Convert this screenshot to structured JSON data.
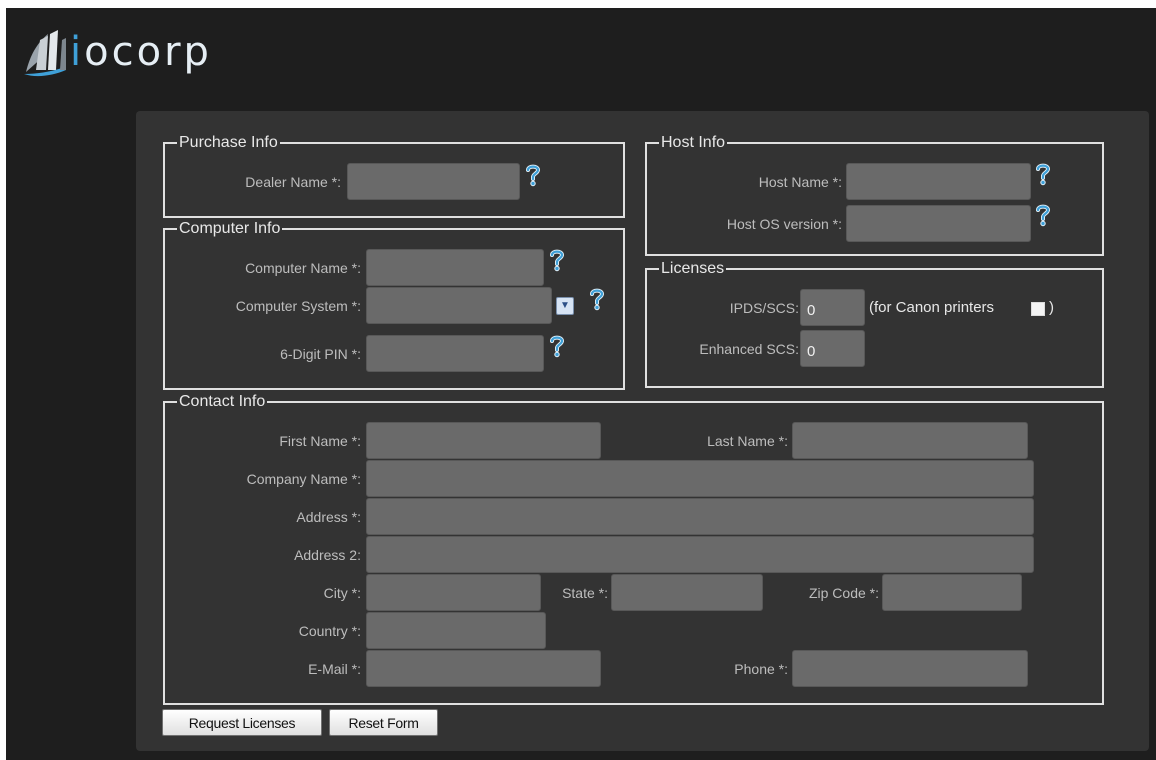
{
  "brand": {
    "logo_text": "iocorp",
    "logo_prefix": "i",
    "logo_rest": "ocorp"
  },
  "sections": {
    "purchase": {
      "legend": "Purchase Info",
      "dealer_label": "Dealer Name *:",
      "dealer_value": ""
    },
    "computer": {
      "legend": "Computer Info",
      "name_label": "Computer Name *:",
      "name_value": "",
      "system_label": "Computer System *:",
      "system_value": "",
      "pin_label": "6-Digit PIN *:",
      "pin_value": ""
    },
    "host": {
      "legend": "Host Info",
      "name_label": "Host Name *:",
      "name_value": "",
      "os_label": "Host OS version *:",
      "os_value": ""
    },
    "licenses": {
      "legend": "Licenses",
      "ipds_label": "IPDS/SCS:",
      "ipds_value": "0",
      "canon_label": "(for Canon printers",
      "canon_close": ")",
      "enhanced_label": "Enhanced SCS:",
      "enhanced_value": "0"
    },
    "contact": {
      "legend": "Contact Info",
      "first_label": "First Name *:",
      "last_label": "Last Name *:",
      "company_label": "Company Name *:",
      "address_label": "Address *:",
      "address2_label": "Address 2:",
      "city_label": "City *:",
      "state_label": "State *:",
      "zip_label": "Zip Code *:",
      "country_label": "Country *:",
      "email_label": "E-Mail *:",
      "phone_label": "Phone *:"
    }
  },
  "buttons": {
    "request": "Request Licenses",
    "reset": "Reset Form"
  },
  "colors": {
    "page_bg": "#1e1e1e",
    "panel_bg": "#333333",
    "field_bg": "#6a6a6a",
    "help_icon": "#3fa0d8"
  }
}
